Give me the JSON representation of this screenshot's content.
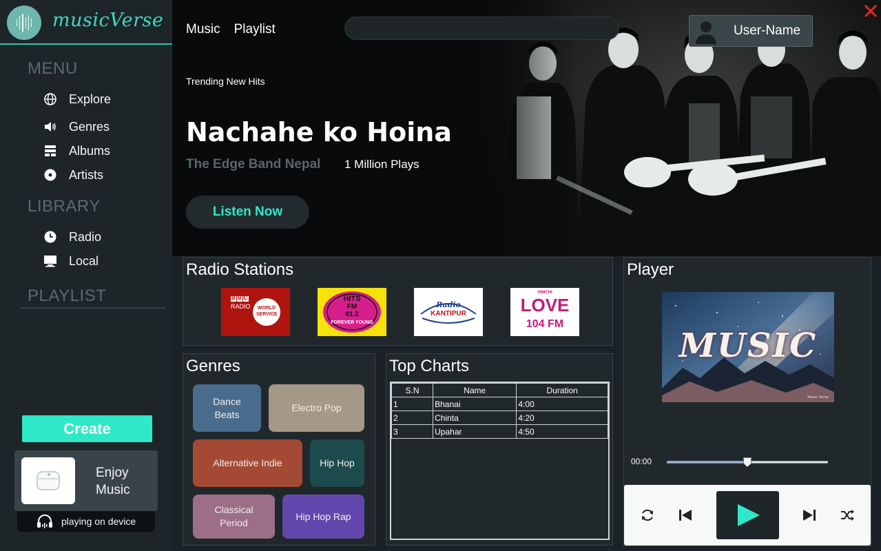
{
  "app": {
    "logo_text": "musicVerse",
    "accent": "#2ee8c8"
  },
  "sidebar": {
    "menu_title": "MENU",
    "menu_items": [
      {
        "label": "Explore",
        "icon": "globe-icon"
      },
      {
        "label": "Genres",
        "icon": "speaker-icon"
      },
      {
        "label": "Albums",
        "icon": "albums-icon"
      },
      {
        "label": "Artists",
        "icon": "disc-icon"
      }
    ],
    "library_title": "LIBRARY",
    "library_items": [
      {
        "label": "Radio",
        "icon": "clock-icon"
      },
      {
        "label": "Local",
        "icon": "monitor-icon"
      }
    ],
    "playlist_title": "PLAYLIST",
    "create_label": "Create",
    "device": {
      "line1": "Enjoy",
      "line2": "Music",
      "status": "playing on device"
    }
  },
  "header": {
    "nav": [
      "Music",
      "Playlist"
    ],
    "search_placeholder": "",
    "user_name": "User-Name"
  },
  "hero": {
    "tag": "Trending New Hits",
    "title": "Nachahe ko Hoina",
    "artist": "The Edge Band Nepal",
    "plays": "1 Million Plays",
    "cta": "Listen Now"
  },
  "radio": {
    "title": "Radio Stations",
    "stations": [
      {
        "name": "BBC Radio World Service",
        "line1": "BBC",
        "line2": "RADIO",
        "line3": "WORLD",
        "line4": "SERVICE",
        "bg": "#b0140f"
      },
      {
        "name": "Hits FM 91.2",
        "line1": "HITS",
        "line2": "FM",
        "line3": "91.2",
        "line4": "FOREVER YOUNG",
        "bg": "#f5e20a"
      },
      {
        "name": "Radio Kantipur",
        "line1": "Radio",
        "line2": "KANTIPUR",
        "bg": "#ffffff"
      },
      {
        "name": "Love 104 FM",
        "line1": "HIMCHI",
        "line2": "LOVE",
        "line3": "104 FM",
        "bg": "#ffffff"
      }
    ]
  },
  "genres": {
    "title": "Genres",
    "items": [
      {
        "label": "Dance\nBeats",
        "line1": "Dance",
        "line2": "Beats",
        "color": "#4a6c8c"
      },
      {
        "label": "Electro Pop",
        "line1": "Electro Pop",
        "line2": "",
        "color": "#a49886"
      },
      {
        "label": "Alternative Indie",
        "line1": "Alternative Indie",
        "line2": "",
        "color": "#a44a34"
      },
      {
        "label": "Hip Hop",
        "line1": "Hip Hop",
        "line2": "",
        "color": "#1d4a4c"
      },
      {
        "label": "Classical Period",
        "line1": "Classical",
        "line2": "Period",
        "color": "#9c6e88"
      },
      {
        "label": "Hip Hop Rap",
        "line1": "Hip Hop Rap",
        "line2": "",
        "color": "#6248ac"
      }
    ]
  },
  "charts": {
    "title": "Top Charts",
    "columns": [
      "S.N",
      "Name",
      "Duration"
    ],
    "rows": [
      [
        "1",
        "Bhanai",
        "4:00"
      ],
      [
        "2",
        "Chinta",
        "4:20"
      ],
      [
        "3",
        "Upahar",
        "4:50"
      ]
    ]
  },
  "player": {
    "title": "Player",
    "album_text": "MUSIC",
    "album_signature": "Music Verse",
    "current_time": "00:00",
    "progress": 0.5
  }
}
